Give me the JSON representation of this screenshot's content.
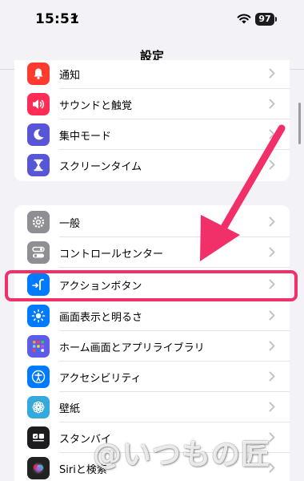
{
  "status": {
    "time": "15:51",
    "battery": "97"
  },
  "nav": {
    "title": "設定"
  },
  "group1": [
    {
      "label": "通知",
      "icon": "bell-icon",
      "color": "#ff3b30"
    },
    {
      "label": "サウンドと触覚",
      "icon": "speaker-icon",
      "color": "#ff2d55"
    },
    {
      "label": "集中モード",
      "icon": "moon-icon",
      "color": "#5856d6"
    },
    {
      "label": "スクリーンタイム",
      "icon": "hourglass-icon",
      "color": "#5856d6"
    }
  ],
  "group2": [
    {
      "label": "一般",
      "icon": "gear-icon",
      "color": "#8e8e93"
    },
    {
      "label": "コントロールセンター",
      "icon": "toggle-icon",
      "color": "#8e8e93"
    },
    {
      "label": "アクションボタン",
      "icon": "action-button-icon",
      "color": "#007aff"
    },
    {
      "label": "画面表示と明るさ",
      "icon": "sun-icon",
      "color": "#007aff"
    },
    {
      "label": "ホーム画面とアプリライブラリ",
      "icon": "app-grid-icon",
      "color": "#5e5ce6"
    },
    {
      "label": "アクセシビリティ",
      "icon": "accessibility-icon",
      "color": "#007aff"
    },
    {
      "label": "壁紙",
      "icon": "flower-icon",
      "color": "#34aadc"
    },
    {
      "label": "スタンバイ",
      "icon": "standby-icon",
      "color": "#1c1c1e"
    },
    {
      "label": "Siriと検索",
      "icon": "siri-icon",
      "color": "#222222"
    }
  ],
  "annotation": {
    "color": "#f1306a"
  },
  "watermark": "@いつもの匠"
}
